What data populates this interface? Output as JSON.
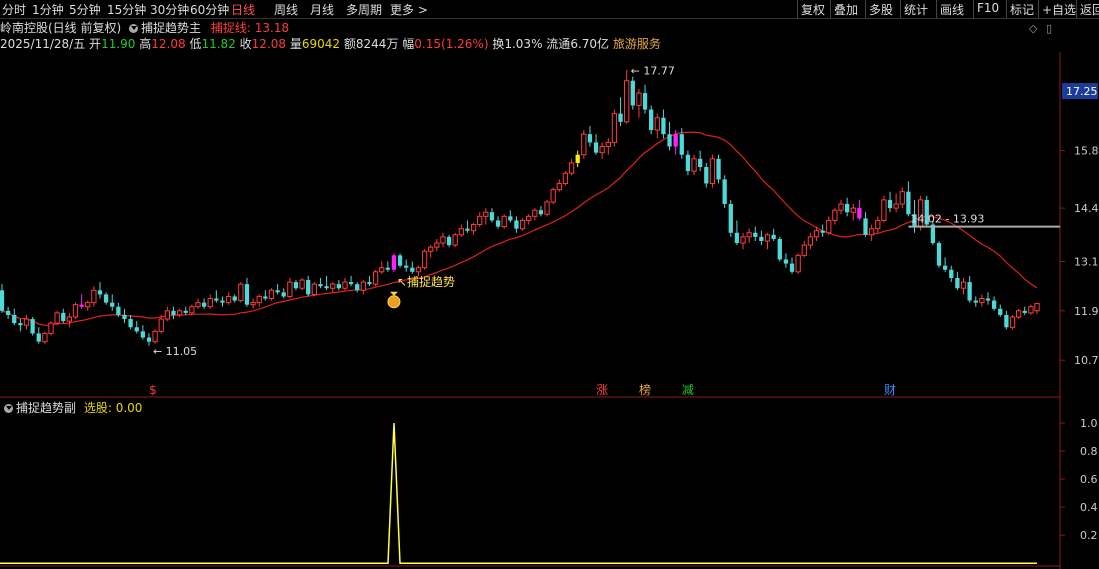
{
  "toolbar": {
    "left": [
      "分时",
      "1分钟",
      "5分钟",
      "15分钟",
      "30分钟",
      "60分钟",
      "日线",
      "周线",
      "月线",
      "多周期",
      "更多 >"
    ],
    "right": [
      "复权",
      "叠加",
      "多股",
      "统计",
      "画线",
      "F10",
      "标记",
      "+自选",
      "返回"
    ]
  },
  "header": {
    "stock": "岭南控股(日线 前复权)",
    "indicator": "捕捉趋势主",
    "capture_label": "捕捉线:",
    "capture_value": "13.18"
  },
  "quote": {
    "date": "2025/11/28/五",
    "open_label": "开",
    "open": "11.90",
    "high_label": "高",
    "high": "12.08",
    "low_label": "低",
    "low": "11.82",
    "close_label": "收",
    "close": "12.08",
    "vol_label": "量",
    "vol": "69042",
    "amt_label": "额",
    "amt": "8244万",
    "chg_label": "幅",
    "chg": "0.15(1.26%)",
    "turn_label": "换",
    "turn": "1.03%",
    "float_label": "流通",
    "float": "6.70亿",
    "sector": "旅游服务"
  },
  "sub_panel": {
    "name": "捕捉趋势副",
    "value_label": "选股:",
    "value": "0.00"
  },
  "colors": {
    "up": "#ff3b3b",
    "down": "#4fd8d8",
    "ma": "#e02020",
    "signal": "#ff22ff",
    "limit": "#ffee00",
    "sub_line": "#ffff44"
  },
  "chart_data": {
    "type": "candlestick",
    "price_axis": {
      "ticks": [
        "17.25",
        "15.8",
        "14.4",
        "13.1",
        "11.9",
        "10.7"
      ],
      "range": [
        9.9,
        18.2
      ],
      "current": "17.25"
    },
    "sub_axis": {
      "ticks": [
        "1.0",
        "0.8",
        "0.6",
        "0.4",
        "0.2"
      ],
      "range": [
        -0.02,
        1.05
      ]
    },
    "annotations": {
      "high": "17.77",
      "low": "11.05",
      "signal_text": "捕捉趋势",
      "range_label": "14.02 - 13.93",
      "range_level": 13.95
    },
    "event_markers": [
      {
        "text": "$",
        "index": 25,
        "color": "#ff3b3b"
      },
      {
        "text": "涨",
        "index": 98,
        "color": "#ff3b3b"
      },
      {
        "text": "榜",
        "index": 105,
        "color": "#e7a940"
      },
      {
        "text": "减",
        "index": 112,
        "color": "#22cc22"
      },
      {
        "text": "财",
        "index": 145,
        "color": "#3a8cff"
      }
    ],
    "signal_index": 64,
    "sub_values_peak": {
      "index": 64,
      "value": 1.0
    },
    "ohlc": [
      [
        12.4,
        12.55,
        11.85,
        11.9
      ],
      [
        11.9,
        12.0,
        11.7,
        11.8
      ],
      [
        11.8,
        11.95,
        11.55,
        11.6
      ],
      [
        11.6,
        11.7,
        11.4,
        11.55
      ],
      [
        11.55,
        11.8,
        11.45,
        11.7
      ],
      [
        11.7,
        11.75,
        11.3,
        11.35
      ],
      [
        11.35,
        11.5,
        11.1,
        11.15
      ],
      [
        11.15,
        11.4,
        11.1,
        11.35
      ],
      [
        11.35,
        11.65,
        11.3,
        11.6
      ],
      [
        11.6,
        11.9,
        11.55,
        11.85
      ],
      [
        11.85,
        11.95,
        11.6,
        11.65
      ],
      [
        11.65,
        11.85,
        11.5,
        11.75
      ],
      [
        11.75,
        12.1,
        11.7,
        12.05
      ],
      [
        12.05,
        12.3,
        11.95,
        12.0
      ],
      [
        12.0,
        12.15,
        11.9,
        12.1
      ],
      [
        12.1,
        12.5,
        12.0,
        12.4
      ],
      [
        12.4,
        12.6,
        12.2,
        12.3
      ],
      [
        12.3,
        12.35,
        12.05,
        12.1
      ],
      [
        12.1,
        12.3,
        11.9,
        12.0
      ],
      [
        12.0,
        12.1,
        11.75,
        11.8
      ],
      [
        11.8,
        11.95,
        11.6,
        11.7
      ],
      [
        11.7,
        11.8,
        11.45,
        11.5
      ],
      [
        11.5,
        11.65,
        11.35,
        11.4
      ],
      [
        11.4,
        11.55,
        11.2,
        11.25
      ],
      [
        11.25,
        11.35,
        11.05,
        11.15
      ],
      [
        11.15,
        11.45,
        11.1,
        11.4
      ],
      [
        11.4,
        11.8,
        11.35,
        11.7
      ],
      [
        11.7,
        12.0,
        11.65,
        11.9
      ],
      [
        11.9,
        12.0,
        11.7,
        11.8
      ],
      [
        11.8,
        11.95,
        11.75,
        11.9
      ],
      [
        11.9,
        12.0,
        11.8,
        11.85
      ],
      [
        11.85,
        12.05,
        11.8,
        12.0
      ],
      [
        12.0,
        12.2,
        11.95,
        12.1
      ],
      [
        12.1,
        12.2,
        11.95,
        12.0
      ],
      [
        12.0,
        12.3,
        11.95,
        12.2
      ],
      [
        12.2,
        12.4,
        12.1,
        12.15
      ],
      [
        12.15,
        12.25,
        12.0,
        12.1
      ],
      [
        12.1,
        12.35,
        12.05,
        12.25
      ],
      [
        12.25,
        12.3,
        12.1,
        12.15
      ],
      [
        12.15,
        12.6,
        12.1,
        12.55
      ],
      [
        12.55,
        12.7,
        12.0,
        12.05
      ],
      [
        12.05,
        12.2,
        11.95,
        12.1
      ],
      [
        12.1,
        12.3,
        12.0,
        12.25
      ],
      [
        12.25,
        12.4,
        12.15,
        12.2
      ],
      [
        12.2,
        12.45,
        12.15,
        12.4
      ],
      [
        12.4,
        12.55,
        12.3,
        12.35
      ],
      [
        12.35,
        12.45,
        12.2,
        12.25
      ],
      [
        12.25,
        12.7,
        12.2,
        12.6
      ],
      [
        12.6,
        12.65,
        12.4,
        12.45
      ],
      [
        12.45,
        12.7,
        12.4,
        12.65
      ],
      [
        12.65,
        12.75,
        12.25,
        12.3
      ],
      [
        12.3,
        12.6,
        12.25,
        12.55
      ],
      [
        12.55,
        12.7,
        12.45,
        12.5
      ],
      [
        12.5,
        12.75,
        12.4,
        12.45
      ],
      [
        12.45,
        12.6,
        12.35,
        12.55
      ],
      [
        12.55,
        12.65,
        12.4,
        12.45
      ],
      [
        12.45,
        12.7,
        12.4,
        12.6
      ],
      [
        12.6,
        12.75,
        12.5,
        12.55
      ],
      [
        12.55,
        12.6,
        12.35,
        12.4
      ],
      [
        12.4,
        12.65,
        12.3,
        12.6
      ],
      [
        12.6,
        12.75,
        12.5,
        12.55
      ],
      [
        12.55,
        12.9,
        12.5,
        12.85
      ],
      [
        12.85,
        13.1,
        12.8,
        12.95
      ],
      [
        12.95,
        13.1,
        12.85,
        12.9
      ],
      [
        12.9,
        13.3,
        12.85,
        13.25
      ],
      [
        13.25,
        13.3,
        12.95,
        13.0
      ],
      [
        13.0,
        13.15,
        12.85,
        12.95
      ],
      [
        12.95,
        13.1,
        12.8,
        12.85
      ],
      [
        12.85,
        13.0,
        12.75,
        12.95
      ],
      [
        12.95,
        13.4,
        12.9,
        13.35
      ],
      [
        13.35,
        13.5,
        13.2,
        13.45
      ],
      [
        13.45,
        13.65,
        13.35,
        13.55
      ],
      [
        13.55,
        13.8,
        13.45,
        13.7
      ],
      [
        13.7,
        13.75,
        13.45,
        13.5
      ],
      [
        13.5,
        13.8,
        13.45,
        13.75
      ],
      [
        13.75,
        14.0,
        13.7,
        13.9
      ],
      [
        13.9,
        14.1,
        13.8,
        13.85
      ],
      [
        13.85,
        14.05,
        13.75,
        14.0
      ],
      [
        14.0,
        14.3,
        13.95,
        14.2
      ],
      [
        14.2,
        14.4,
        14.0,
        14.3
      ],
      [
        14.3,
        14.4,
        14.05,
        14.1
      ],
      [
        14.1,
        14.2,
        13.9,
        13.95
      ],
      [
        13.95,
        14.25,
        13.9,
        14.2
      ],
      [
        14.2,
        14.35,
        14.05,
        14.1
      ],
      [
        14.1,
        14.2,
        13.8,
        13.9
      ],
      [
        13.9,
        14.15,
        13.85,
        14.1
      ],
      [
        14.1,
        14.25,
        14.0,
        14.2
      ],
      [
        14.2,
        14.4,
        14.1,
        14.35
      ],
      [
        14.35,
        14.45,
        14.2,
        14.25
      ],
      [
        14.25,
        14.6,
        14.2,
        14.55
      ],
      [
        14.55,
        14.9,
        14.5,
        14.85
      ],
      [
        14.85,
        15.1,
        14.8,
        15.0
      ],
      [
        15.0,
        15.3,
        14.95,
        15.25
      ],
      [
        15.25,
        15.6,
        15.2,
        15.5
      ],
      [
        15.5,
        15.8,
        15.4,
        15.7
      ],
      [
        15.7,
        16.3,
        15.6,
        16.2
      ],
      [
        16.2,
        16.4,
        15.9,
        16.0
      ],
      [
        16.0,
        16.2,
        15.7,
        15.75
      ],
      [
        15.75,
        16.0,
        15.6,
        15.9
      ],
      [
        15.9,
        16.1,
        15.7,
        16.0
      ],
      [
        16.0,
        16.8,
        15.9,
        16.7
      ],
      [
        16.7,
        17.1,
        16.4,
        16.5
      ],
      [
        16.5,
        17.77,
        16.45,
        17.5
      ],
      [
        17.5,
        17.6,
        16.8,
        16.9
      ],
      [
        16.9,
        17.3,
        16.6,
        17.2
      ],
      [
        17.2,
        17.4,
        16.7,
        16.8
      ],
      [
        16.8,
        16.9,
        16.2,
        16.3
      ],
      [
        16.3,
        16.7,
        16.1,
        16.6
      ],
      [
        16.6,
        16.8,
        16.1,
        16.2
      ],
      [
        16.2,
        16.5,
        15.8,
        15.9
      ],
      [
        15.9,
        16.3,
        15.7,
        16.2
      ],
      [
        16.2,
        16.35,
        15.6,
        15.7
      ],
      [
        15.7,
        15.8,
        15.2,
        15.3
      ],
      [
        15.3,
        15.7,
        15.2,
        15.6
      ],
      [
        15.6,
        15.8,
        15.3,
        15.4
      ],
      [
        15.4,
        15.5,
        14.9,
        15.0
      ],
      [
        15.0,
        15.7,
        14.9,
        15.6
      ],
      [
        15.6,
        15.7,
        15.0,
        15.1
      ],
      [
        15.1,
        15.2,
        14.4,
        14.5
      ],
      [
        14.5,
        14.6,
        13.7,
        13.8
      ],
      [
        13.8,
        14.1,
        13.5,
        13.55
      ],
      [
        13.55,
        13.8,
        13.4,
        13.7
      ],
      [
        13.7,
        13.9,
        13.55,
        13.8
      ],
      [
        13.8,
        13.95,
        13.6,
        13.7
      ],
      [
        13.7,
        13.85,
        13.5,
        13.6
      ],
      [
        13.6,
        13.8,
        13.4,
        13.75
      ],
      [
        13.75,
        13.9,
        13.6,
        13.65
      ],
      [
        13.65,
        13.7,
        13.1,
        13.15
      ],
      [
        13.15,
        13.3,
        12.95,
        13.05
      ],
      [
        13.05,
        13.2,
        12.8,
        12.85
      ],
      [
        12.85,
        13.3,
        12.8,
        13.25
      ],
      [
        13.25,
        13.6,
        13.2,
        13.5
      ],
      [
        13.5,
        13.8,
        13.4,
        13.7
      ],
      [
        13.7,
        13.95,
        13.6,
        13.85
      ],
      [
        13.85,
        14.0,
        13.7,
        13.8
      ],
      [
        13.8,
        14.2,
        13.75,
        14.1
      ],
      [
        14.1,
        14.4,
        14.0,
        14.35
      ],
      [
        14.35,
        14.6,
        14.25,
        14.5
      ],
      [
        14.5,
        14.65,
        14.2,
        14.3
      ],
      [
        14.3,
        14.5,
        14.1,
        14.4
      ],
      [
        14.4,
        14.6,
        14.1,
        14.15
      ],
      [
        14.15,
        14.3,
        13.7,
        13.75
      ],
      [
        13.75,
        14.0,
        13.6,
        13.9
      ],
      [
        13.9,
        14.2,
        13.8,
        14.1
      ],
      [
        14.1,
        14.7,
        14.05,
        14.6
      ],
      [
        14.6,
        14.8,
        14.3,
        14.4
      ],
      [
        14.4,
        14.75,
        14.3,
        14.5
      ],
      [
        14.5,
        14.9,
        14.4,
        14.8
      ],
      [
        14.8,
        15.05,
        14.2,
        14.25
      ],
      [
        14.25,
        14.6,
        13.8,
        13.95
      ],
      [
        13.95,
        14.7,
        13.85,
        14.6
      ],
      [
        14.6,
        14.7,
        13.95,
        14.0
      ],
      [
        14.0,
        14.1,
        13.5,
        13.55
      ],
      [
        13.55,
        13.6,
        12.95,
        13.0
      ],
      [
        13.0,
        13.2,
        12.85,
        12.9
      ],
      [
        12.9,
        13.0,
        12.6,
        12.7
      ],
      [
        12.7,
        12.85,
        12.4,
        12.45
      ],
      [
        12.45,
        12.7,
        12.3,
        12.6
      ],
      [
        12.6,
        12.75,
        12.1,
        12.15
      ],
      [
        12.15,
        12.25,
        12.0,
        12.1
      ],
      [
        12.1,
        12.3,
        12.0,
        12.2
      ],
      [
        12.2,
        12.35,
        12.05,
        12.15
      ],
      [
        12.15,
        12.25,
        11.9,
        11.95
      ],
      [
        11.95,
        12.05,
        11.75,
        11.8
      ],
      [
        11.8,
        11.9,
        11.45,
        11.5
      ],
      [
        11.5,
        11.8,
        11.45,
        11.75
      ],
      [
        11.75,
        11.95,
        11.7,
        11.9
      ],
      [
        11.9,
        12.0,
        11.8,
        11.85
      ],
      [
        11.85,
        12.05,
        11.8,
        12.0
      ],
      [
        11.9,
        12.08,
        11.82,
        12.08
      ]
    ]
  }
}
